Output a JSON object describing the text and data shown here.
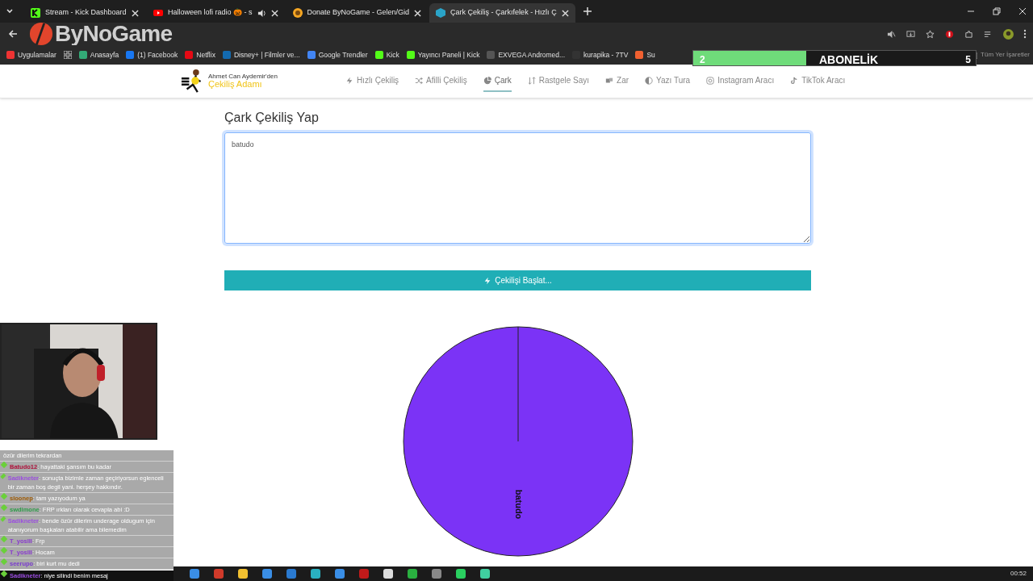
{
  "browser": {
    "tabs": [
      {
        "title": "Stream - Kick Dashboard",
        "selected": false,
        "audio": false
      },
      {
        "title": "Halloween lofi radio 🎃 - s",
        "selected": false,
        "audio": true
      },
      {
        "title": "Donate ByNoGame - Gelen/Gid",
        "selected": false,
        "audio": false
      },
      {
        "title": "Çark Çekiliş - Çarkıfelek - Hızlı Ç",
        "selected": true,
        "audio": false
      }
    ],
    "bookmarks": [
      "Uygulamalar",
      "Anasayfa",
      "(1) Facebook",
      "Netflix",
      "Disney+ | Filmler ve...",
      "Google Trendler",
      "Kick",
      "Yayıncı Paneli | Kick",
      "EXVEGA Andromed...",
      "kurapika - 7TV",
      "Su"
    ],
    "all_bookmarks": "Tüm Yer İşaretler"
  },
  "overlay_logo": "ByNoGame",
  "sub_goal": {
    "current": "2",
    "label": "ABONELİK",
    "target": "5",
    "level": 0.4
  },
  "site": {
    "logo_top": "Ahmet Can Aydemir'den",
    "logo_bottom": "Çekiliş Adamı",
    "nav": [
      {
        "label": "Hızlı Çekiliş",
        "selected": false
      },
      {
        "label": "Afilli Çekiliş",
        "selected": false
      },
      {
        "label": "Çark",
        "selected": true
      },
      {
        "label": "Rastgele Sayı",
        "selected": false
      },
      {
        "label": "Zar",
        "selected": false
      },
      {
        "label": "Yazı Tura",
        "selected": false
      },
      {
        "label": "Instagram Aracı",
        "selected": false
      },
      {
        "label": "TikTok Aracı",
        "selected": false
      }
    ],
    "heading": "Çark Çekiliş Yap",
    "entries": "batudo",
    "start_button": "Çekilişi Başlat...",
    "wheel": {
      "segments": [
        {
          "label": "batudo",
          "color": "#7b33f6"
        }
      ]
    }
  },
  "chat": [
    {
      "text": "özür dilerim tekrardan"
    },
    {
      "user": "Batudo12",
      "color": "#b0103a",
      "text": ": hayattaki şansım bu kadar"
    },
    {
      "user": "Sadikneter",
      "color": "#9b4de0",
      "text": ": sonuçta bizimle zaman geçiriyorsun eglenceli bir zaman boş degil yani. herşey hakkındır."
    },
    {
      "user": "sloonep",
      "color": "#a05a00",
      "text": ": tam yazıyodum ya"
    },
    {
      "user": "swdimone",
      "color": "#2e9e4a",
      "text": ": FRP ırkları olarak cevapla abi :D"
    },
    {
      "user": "Sadikneter",
      "color": "#9b4de0",
      "text": ": bende özür dilerim underage oldugum için atanıyorum başkaları atabilir ama bilemedim"
    },
    {
      "user": "T_yoslll",
      "color": "#8a3ad0",
      "text": ": Frp"
    },
    {
      "user": "T_yoslll",
      "color": "#8a3ad0",
      "text": ": Hocam"
    },
    {
      "user": "seerupo",
      "color": "#7a3ad0",
      "text": ": biri kurt mu dedi"
    }
  ],
  "chat_latest": {
    "user": "Sadikneter",
    "color": "#9b4de0",
    "text": ": niye silindi benim mesaj"
  },
  "taskbar": {
    "time": "00:52"
  }
}
